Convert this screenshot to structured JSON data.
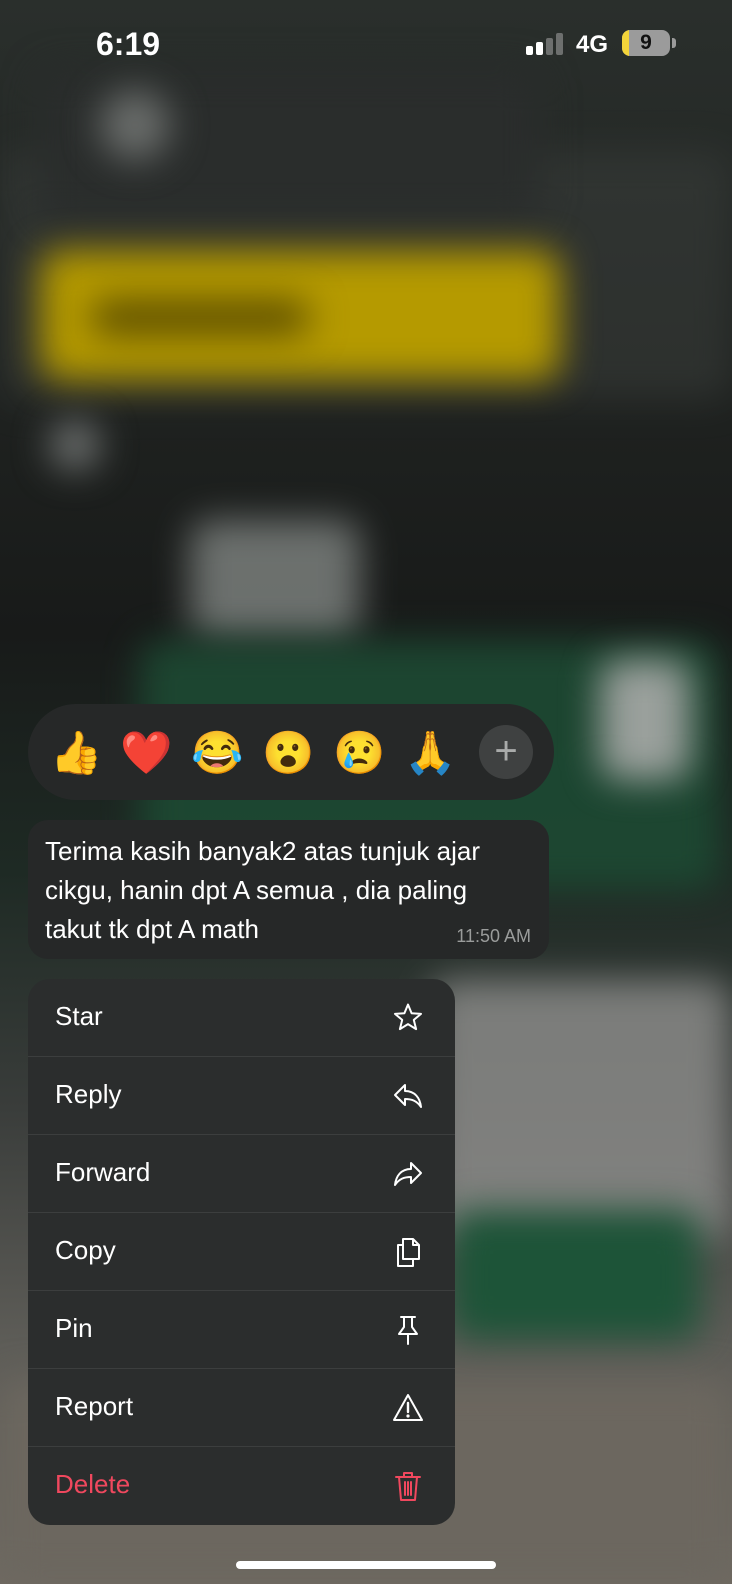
{
  "status_bar": {
    "time": "6:19",
    "network": "4G",
    "battery_level": "9",
    "battery_fraction": 0.09,
    "signal_bars_active": 2,
    "signal_bars_total": 4
  },
  "reactions": {
    "emojis": [
      "👍",
      "❤️",
      "😂",
      "😮",
      "😢",
      "🙏"
    ],
    "add_icon": "plus-icon"
  },
  "message": {
    "text": "Terima kasih banyak2 atas tunjuk ajar cikgu, hanin dpt A semua , dia paling takut tk dpt A math",
    "time": "11:50 AM"
  },
  "menu": {
    "items": [
      {
        "label": "Star",
        "icon": "star-icon"
      },
      {
        "label": "Reply",
        "icon": "reply-icon"
      },
      {
        "label": "Forward",
        "icon": "forward-icon"
      },
      {
        "label": "Copy",
        "icon": "copy-icon"
      },
      {
        "label": "Pin",
        "icon": "pin-icon"
      },
      {
        "label": "Report",
        "icon": "warning-icon"
      },
      {
        "label": "Delete",
        "icon": "trash-icon"
      }
    ]
  },
  "colors": {
    "danger": "#f0485e",
    "panel": "#2b2d2d",
    "battery": "#f3d43a"
  }
}
